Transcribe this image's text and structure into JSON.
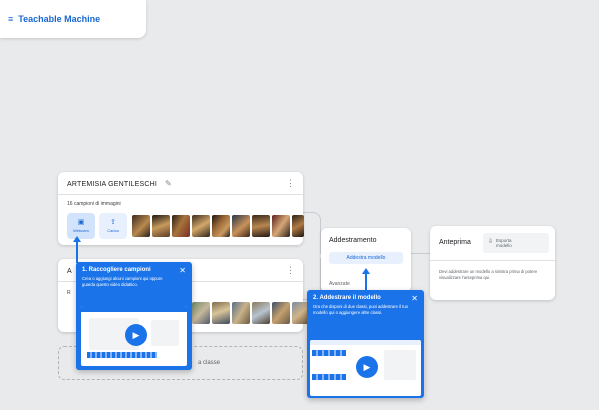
{
  "header": {
    "menu_icon": "≡",
    "title": "Teachable Machine"
  },
  "class1": {
    "title": "ARTEMISIA GENTILESCHI",
    "samples_label": "16 campioni di immagini",
    "webcam_label": "Webcam",
    "upload_label": "Carica"
  },
  "class2": {
    "title_partial": "A",
    "samples_label_partial": "R"
  },
  "tooltip1": {
    "title": "1. Raccogliere campioni",
    "body": "Crea o aggiungi alcuni campioni qui oppure guarda questo video didattico.",
    "close": "✕"
  },
  "tooltip2": {
    "title": "2. Addestrare il modello",
    "body": "Ora che disponi di due classi, puoi addestrare il tuo modello qui o aggiungere altre classi.",
    "close": "✕"
  },
  "training": {
    "title": "Addestramento",
    "button": "Addestra modello",
    "advanced": "Avanzate"
  },
  "preview": {
    "title": "Anteprima",
    "export_label": "Esporta modello",
    "text": "Devi addestrare un modello a sinistra prima di potere visualizzare l'anteprima qui."
  },
  "add_class": {
    "label_partial": "a classe"
  },
  "colors": {
    "accent": "#1a73e8",
    "brand": "#1967d2",
    "background": "#e9eaec"
  }
}
